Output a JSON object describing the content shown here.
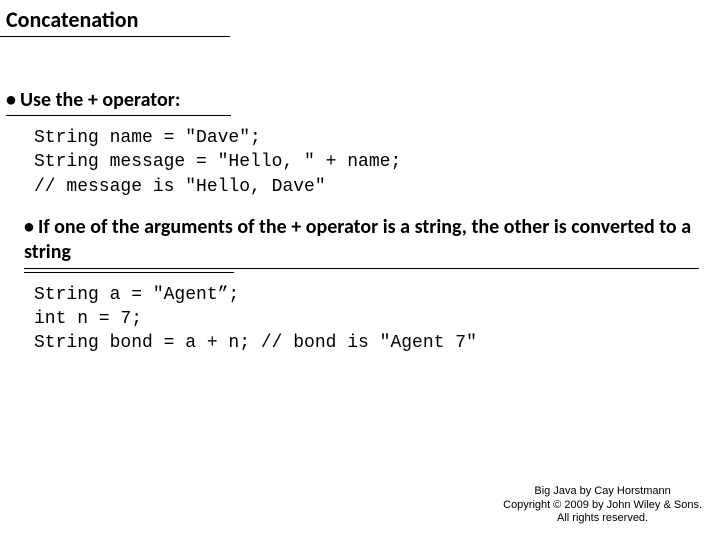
{
  "title": "Concatenation",
  "bullets": {
    "b1": "Use the + operator:",
    "b2": "If one of the arguments of the + operator is a string, the other is converted to a string"
  },
  "code": {
    "block1": "String name = \"Dave\";\nString message = \"Hello, \" + name;\n// message is \"Hello, Dave\"",
    "block2": "String a = \"Agent”;\nint n = 7;\nString bond = a + n; // bond is \"Agent 7\""
  },
  "footer": {
    "line1": "Big Java by Cay Horstmann",
    "line2": "Copyright © 2009 by John Wiley & Sons.",
    "line3": "All rights reserved."
  }
}
